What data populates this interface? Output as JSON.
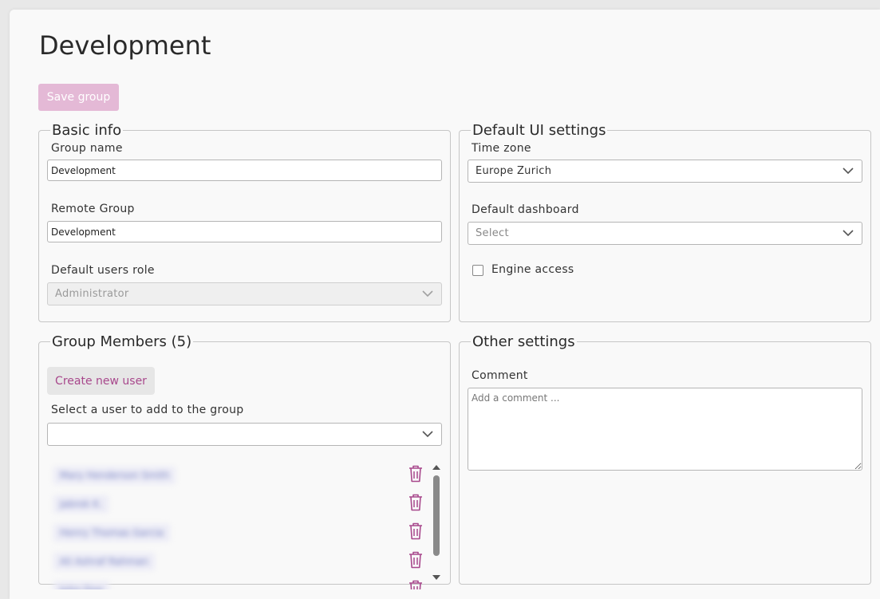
{
  "page": {
    "title": "Development",
    "save_label": "Save group"
  },
  "basic_info": {
    "legend": "Basic info",
    "group_name_label": "Group name",
    "group_name_value": "Development",
    "remote_group_label": "Remote Group",
    "remote_group_value": "Development",
    "default_role_label": "Default users role",
    "default_role_value": "Administrator"
  },
  "ui_settings": {
    "legend": "Default UI settings",
    "timezone_label": "Time zone",
    "timezone_value": "Europe Zurich",
    "dashboard_label": "Default dashboard",
    "dashboard_value": "Select",
    "engine_access_label": "Engine access",
    "engine_access_checked": false
  },
  "members": {
    "legend": "Group Members (5)",
    "create_label": "Create new user",
    "select_label": "Select a user to add to the group",
    "select_value": "",
    "items": [
      {
        "name": "Mary Henderson Smith"
      },
      {
        "name": "Jabrok K."
      },
      {
        "name": "Henry Thomas Garcia"
      },
      {
        "name": "Ali Ashraf Rahman"
      },
      {
        "name": "John Doe"
      }
    ]
  },
  "other_settings": {
    "legend": "Other settings",
    "comment_label": "Comment",
    "comment_placeholder": "Add a comment ...",
    "comment_value": ""
  },
  "colors": {
    "accent": "#a8488c",
    "save_disabled": "#e4b9d6"
  }
}
